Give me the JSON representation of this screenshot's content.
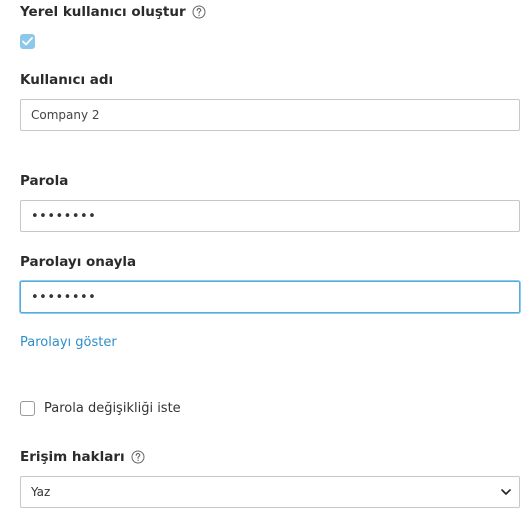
{
  "create_local_user": {
    "label": "Yerel kullanıcı oluştur",
    "checked": true
  },
  "username": {
    "label": "Kullanıcı adı",
    "value": "Company 2"
  },
  "password": {
    "label": "Parola",
    "masked_value": "••••••••"
  },
  "confirm_password": {
    "label": "Parolayı onayla",
    "masked_value": "••••••••"
  },
  "show_password_link": "Parolayı göster",
  "require_password_change": {
    "label": "Parola değişikliği iste",
    "checked": false
  },
  "access_rights": {
    "label": "Erişim hakları",
    "selected": "Yaz"
  },
  "colors": {
    "accent": "#2d8fc9",
    "checkbox_checked": "#8cc8ea",
    "focus_border": "#58a9dc"
  }
}
